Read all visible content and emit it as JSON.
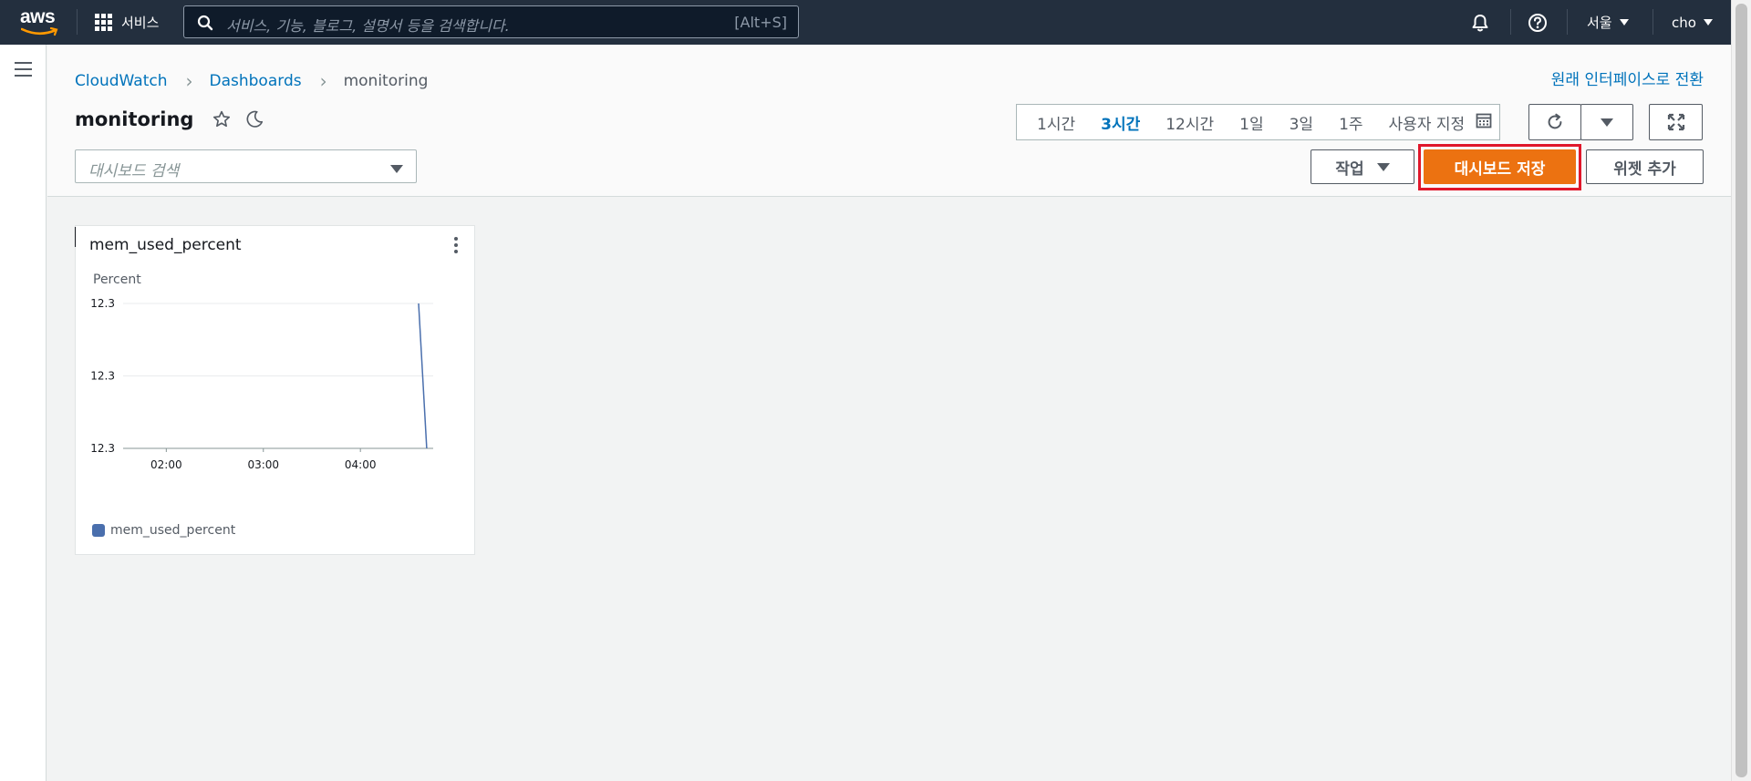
{
  "topnav": {
    "logo_text": "aws",
    "services_label": "서비스",
    "search_placeholder": "서비스, 기능, 블로그, 설명서 등을 검색합니다.",
    "search_shortcut": "[Alt+S]",
    "region": "서울",
    "user": "cho"
  },
  "breadcrumb": {
    "items": [
      "CloudWatch",
      "Dashboards"
    ],
    "current": "monitoring"
  },
  "header": {
    "title": "monitoring",
    "switch_link": "원래 인터페이스로 전환",
    "dashboard_search_placeholder": "대시보드 검색"
  },
  "timerange": {
    "options": [
      "1시간",
      "3시간",
      "12시간",
      "1일",
      "3일",
      "1주"
    ],
    "selected": "3시간",
    "custom_label": "사용자 지정"
  },
  "actions": {
    "actions_label": "작업",
    "save_label": "대시보드 저장",
    "add_widget_label": "위젯 추가"
  },
  "widget": {
    "title": "mem_used_percent",
    "ylabel": "Percent",
    "legend_label": "mem_used_percent"
  },
  "colors": {
    "nav_bg": "#232f3e",
    "primary": "#ec7211",
    "link": "#0073bb",
    "series": "#4a6fad",
    "highlight": "#e0172b"
  },
  "chart_data": {
    "type": "line",
    "title": "mem_used_percent",
    "xlabel": "",
    "ylabel": "Percent",
    "x_ticks": [
      "02:00",
      "03:00",
      "04:00"
    ],
    "y_ticks": [
      "12.3",
      "12.3",
      "12.3"
    ],
    "ylim": [
      12.29,
      12.31
    ],
    "series": [
      {
        "name": "mem_used_percent",
        "color": "#4a6fad",
        "x": [
          "04:36",
          "04:41"
        ],
        "values": [
          12.31,
          12.29
        ]
      }
    ],
    "x_range": [
      "01:35",
      "04:45"
    ],
    "grid": true,
    "legend": "bottom-left"
  }
}
